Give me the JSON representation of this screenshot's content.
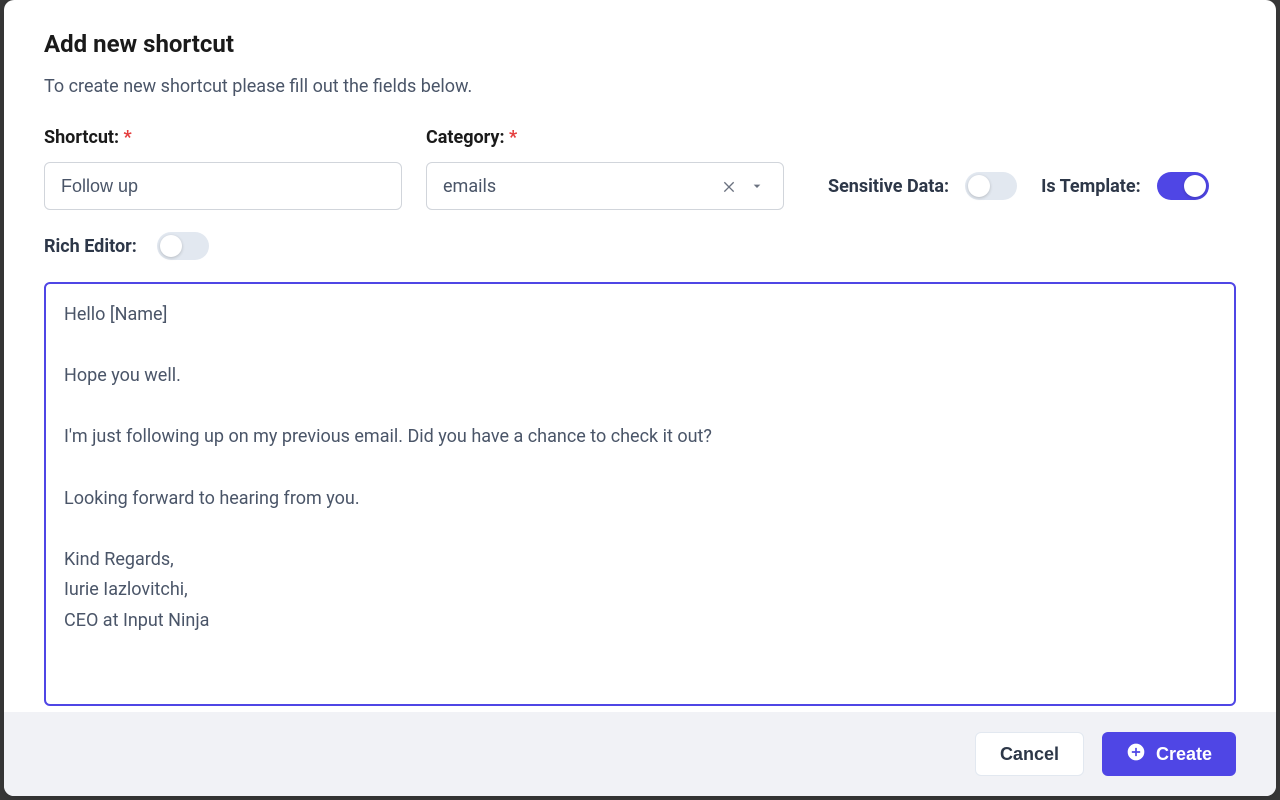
{
  "dialog": {
    "title": "Add new shortcut",
    "subtitle": "To create new shortcut please fill out the fields below."
  },
  "fields": {
    "shortcut": {
      "label": "Shortcut: ",
      "value": "Follow up"
    },
    "category": {
      "label": "Category: ",
      "value": "emails"
    },
    "sensitive_data": {
      "label": "Sensitive Data:",
      "on": false
    },
    "is_template": {
      "label": "Is Template:",
      "on": true
    },
    "rich_editor": {
      "label": "Rich Editor:",
      "on": false
    }
  },
  "editor": {
    "content": "Hello [Name]\n\nHope you well.\n\nI'm just following up on my previous email. Did you have a chance to check it out?\n\nLooking forward to hearing from you.\n\nKind Regards,\nIurie Iazlovitchi,\nCEO at Input Ninja"
  },
  "footer": {
    "cancel": "Cancel",
    "create": "Create"
  },
  "required_marker": "*"
}
